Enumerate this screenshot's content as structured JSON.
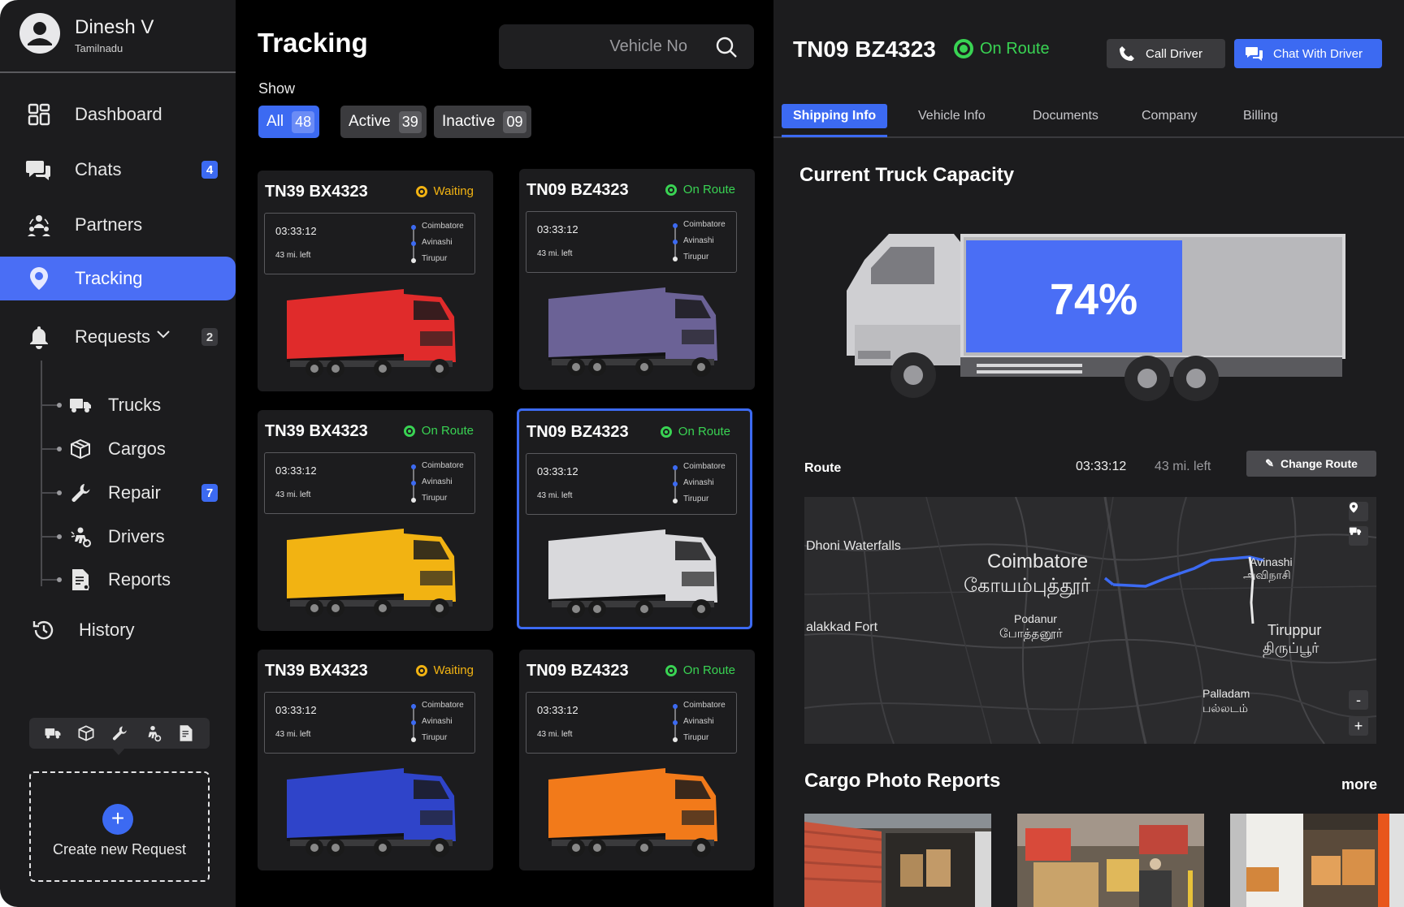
{
  "user": {
    "name": "Dinesh V",
    "region": "Tamilnadu"
  },
  "nav": {
    "dashboard": "Dashboard",
    "chats": "Chats",
    "chats_badge": "4",
    "partners": "Partners",
    "tracking": "Tracking",
    "requests": "Requests",
    "requests_badge": "2",
    "sub": {
      "trucks": "Trucks",
      "cargos": "Cargos",
      "repair": "Repair",
      "repair_badge": "7",
      "drivers": "Drivers",
      "reports": "Reports"
    },
    "history": "History"
  },
  "create_request": {
    "label": "Create new Request",
    "plus": "+"
  },
  "tracking": {
    "title": "Tracking",
    "search_placeholder": "Vehicle No",
    "show_label": "Show",
    "filters": [
      {
        "label": "All",
        "count": "48"
      },
      {
        "label": "Active",
        "count": "39"
      },
      {
        "label": "Inactive",
        "count": "09"
      }
    ],
    "cards": [
      {
        "plate": "TN39 BX4323",
        "status": "Waiting",
        "time": "03:33:12",
        "left": "43 mi. left",
        "stops": [
          "Coimbatore",
          "Avinashi",
          "Tirupur"
        ],
        "truck_color": "#e02b2b"
      },
      {
        "plate": "TN09 BZ4323",
        "status": "On Route",
        "time": "03:33:12",
        "left": "43 mi. left",
        "stops": [
          "Coimbatore",
          "Avinashi",
          "Tirupur"
        ],
        "truck_color": "#6b6296"
      },
      {
        "plate": "TN39 BX4323",
        "status": "On Route",
        "time": "03:33:12",
        "left": "43 mi. left",
        "stops": [
          "Coimbatore",
          "Avinashi",
          "Tirupur"
        ],
        "truck_color": "#f2b312"
      },
      {
        "plate": "TN09 BZ4323",
        "status": "On Route",
        "time": "03:33:12",
        "left": "43 mi. left",
        "stops": [
          "Coimbatore",
          "Avinashi",
          "Tirupur"
        ],
        "truck_color": "#d9d9dc"
      },
      {
        "plate": "TN39 BX4323",
        "status": "Waiting",
        "time": "03:33:12",
        "left": "43 mi. left",
        "stops": [
          "Coimbatore",
          "Avinashi",
          "Tirupur"
        ],
        "truck_color": "#2f44c9"
      },
      {
        "plate": "TN09 BZ4323",
        "status": "On Route",
        "time": "03:33:12",
        "left": "43 mi. left",
        "stops": [
          "Coimbatore",
          "Avinashi",
          "Tirupur"
        ],
        "truck_color": "#f27a1a"
      }
    ]
  },
  "detail": {
    "plate": "TN09 BZ4323",
    "status": "On Route",
    "call_label": "Call Driver",
    "chat_label": "Chat With Driver",
    "tabs": [
      "Shipping Info",
      "Vehicle Info",
      "Documents",
      "Company",
      "Billing"
    ],
    "capacity_title": "Current Truck Capacity",
    "capacity_percent_label": "74%",
    "capacity_fraction": 0.74,
    "route_label": "Route",
    "route_time": "03:33:12",
    "route_left": "43 mi. left",
    "change_route_label": "Change Route",
    "map_labels": {
      "dhoni": "Dhoni Waterfalls",
      "coimbatore": "Coimbatore",
      "coimbatore_ta": "கோயம்புத்தூர்",
      "alakkad": "alakkad Fort",
      "podanur": "Podanur",
      "podanur_ta": "போத்தனூர்",
      "avinashi": "Avinashi",
      "avinashi_ta": "அவிநாசி",
      "tiruppur": "Tiruppur",
      "tiruppur_ta": "திருப்பூர்",
      "palladam": "Palladam",
      "palladam_ta": "பல்லடம்",
      "zoom_out": "-",
      "zoom_in": "+"
    },
    "cargo_title": "Cargo Photo Reports",
    "more_label": "more"
  },
  "colors": {
    "accent": "#3c6af2",
    "on_route": "#39d353",
    "waiting": "#f2b312"
  }
}
